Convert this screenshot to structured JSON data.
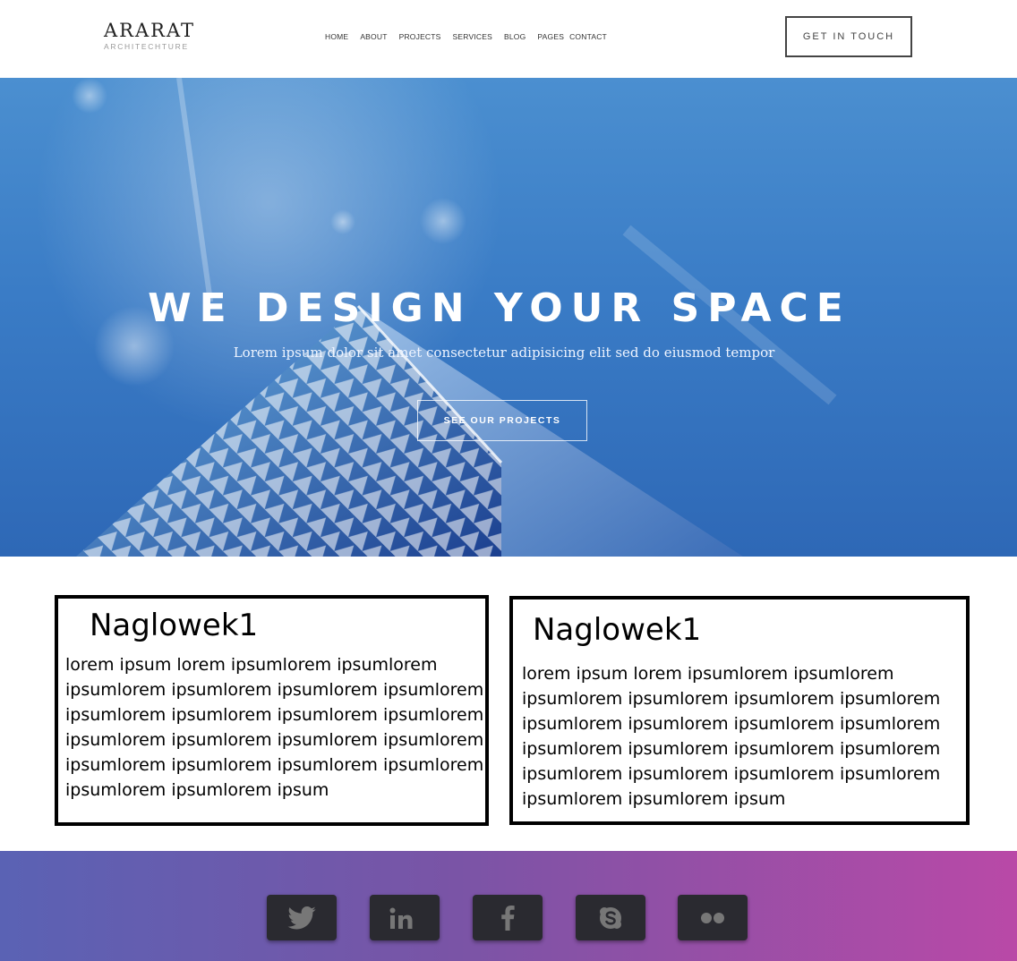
{
  "header": {
    "logo_main": "ARARAT",
    "logo_sub": "ARCHITECHTURE",
    "nav": [
      "HOME",
      "ABOUT",
      "PROJECTS",
      "SERVICES",
      "BLOG",
      "PAGES",
      "CONTACT"
    ],
    "cta_label": "GET IN TOUCH"
  },
  "hero": {
    "title": "WE DESIGN YOUR SPACE",
    "subtitle": "Lorem ipsum dolor sit amet consectetur adipisicing elit sed do eiusmod tempor",
    "button_label": "SEE OUR PROJECTS"
  },
  "cards": [
    {
      "heading": "Naglowek1",
      "lines": [
        "lorem ipsum lorem ipsumlorem ipsumlorem",
        "ipsumlorem ipsumlorem ipsumlorem ipsumlorem",
        "ipsumlorem ipsumlorem ipsumlorem ipsumlorem",
        "ipsumlorem ipsumlorem ipsumlorem ipsumlorem",
        "ipsumlorem ipsumlorem ipsumlorem ipsumlorem",
        "ipsumlorem ipsumlorem ipsum"
      ]
    },
    {
      "heading": "Naglowek1",
      "lines": [
        "lorem ipsum lorem ipsumlorem ipsumlorem",
        "ipsumlorem ipsumlorem ipsumlorem ipsumlorem",
        "ipsumlorem ipsumlorem ipsumlorem ipsumlorem",
        "ipsumlorem ipsumlorem ipsumlorem ipsumlorem",
        "ipsumlorem ipsumlorem ipsumlorem ipsumlorem",
        "ipsumlorem ipsumlorem ipsum"
      ]
    }
  ],
  "footer": {
    "social_icons": [
      "twitter-icon",
      "linkedin-icon",
      "facebook-icon",
      "skype-icon",
      "flickr-icon"
    ]
  },
  "colors": {
    "hero_blue": "#3a7cc6",
    "footer_start": "#5a62b4",
    "footer_end": "#b949a7",
    "social_tile": "#2a2a30"
  }
}
